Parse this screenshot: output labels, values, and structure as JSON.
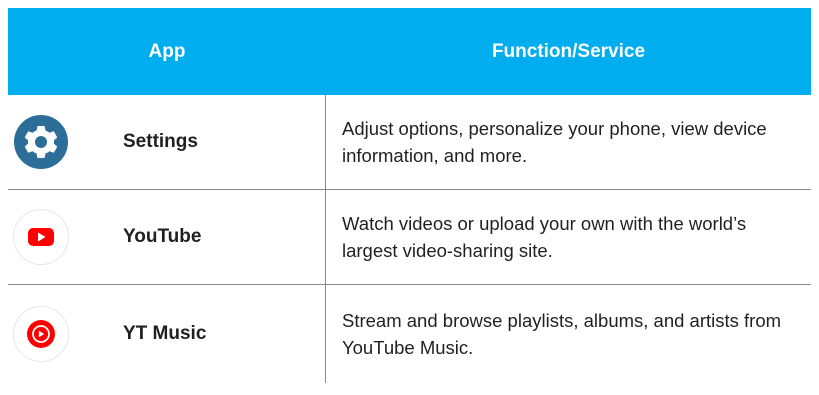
{
  "table": {
    "header": {
      "app": "App",
      "function": "Function/Service"
    },
    "rows": [
      {
        "icon": "settings-gear-icon",
        "app": "Settings",
        "function": "Adjust options, personalize your phone, view device information, and more."
      },
      {
        "icon": "youtube-play-icon",
        "app": "YouTube",
        "function": "Watch videos or upload your own with the world’s largest video-sharing site."
      },
      {
        "icon": "yt-music-icon",
        "app": "YT Music",
        "function": "Stream and browse playlists, albums, and artists from YouTube Music."
      }
    ]
  },
  "colors": {
    "header_bg": "#00aeef",
    "header_text": "#ffffff",
    "settings_icon": "#2c6e97",
    "youtube_red": "#ff0000",
    "divider": "#8a8a8a"
  }
}
